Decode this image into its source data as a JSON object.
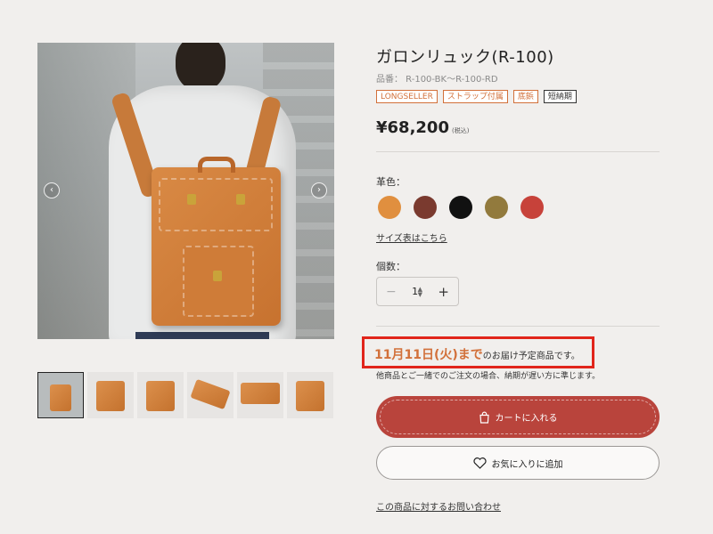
{
  "product": {
    "title": "ガロンリュック(R-100)",
    "sku": "品番： R-100-BK～R-100-RD",
    "badges": [
      {
        "label": "LONGSELLER",
        "style": "accent"
      },
      {
        "label": "ストラップ付属",
        "style": "accent"
      },
      {
        "label": "底鋲",
        "style": "accent"
      },
      {
        "label": "短納期",
        "style": "dark"
      }
    ],
    "price": "¥68,200",
    "tax_note": "(税込)"
  },
  "gallery": {
    "prev_icon": "‹",
    "next_icon": "›",
    "thumbnail_count": 6,
    "active_index": 0
  },
  "options": {
    "color_label": "革色：",
    "colors": [
      {
        "name": "camel",
        "hex": "#e08f3f"
      },
      {
        "name": "brown",
        "hex": "#7a3a2f"
      },
      {
        "name": "black",
        "hex": "#111111"
      },
      {
        "name": "olive",
        "hex": "#927a3d"
      },
      {
        "name": "red",
        "hex": "#c7423a"
      }
    ],
    "size_link": "サイズ表はこちら",
    "qty_label": "個数：",
    "qty_value": "1",
    "minus_icon": "−",
    "plus_icon": "+"
  },
  "delivery": {
    "date": "11月11日(火)まで",
    "rest": "のお届け予定商品です。",
    "note": "他商品とご一緒でのご注文の場合、納期が遅い方に準じます。"
  },
  "actions": {
    "cart_label": "カートに入れる",
    "favorite_label": "お気に入りに追加",
    "inquiry_label": "この商品に対するお問い合わせ"
  },
  "colors": {
    "accent": "#d2703a",
    "cart_button": "#b9443c",
    "highlight_box": "#e1251b"
  }
}
